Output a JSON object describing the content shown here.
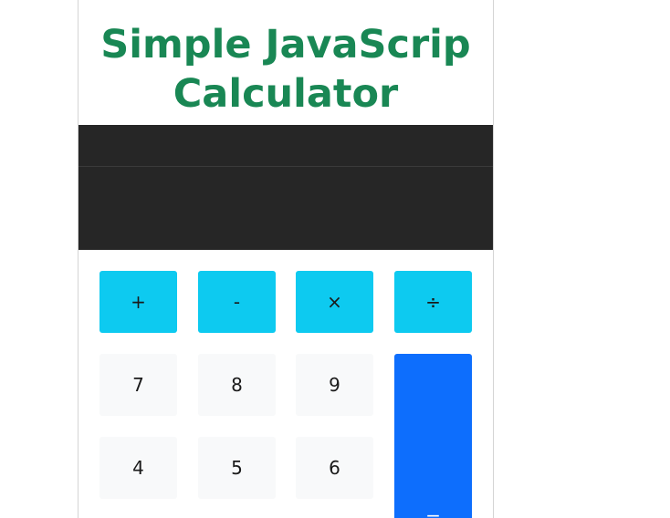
{
  "header": {
    "title": "Simple JavaScrip\nCalculator"
  },
  "display": {
    "previous": "",
    "current": ""
  },
  "operators": {
    "add": "+",
    "subtract": "-",
    "multiply": "×",
    "divide": "÷"
  },
  "digits": {
    "seven": "7",
    "eight": "8",
    "nine": "9",
    "four": "4",
    "five": "5",
    "six": "6"
  },
  "equals_label": "=",
  "colors": {
    "title": "#198754",
    "display_bg": "#262626",
    "operator_button": "#0dcaf0",
    "number_button": "#f8f9fa",
    "equals_button": "#0d6efd"
  }
}
